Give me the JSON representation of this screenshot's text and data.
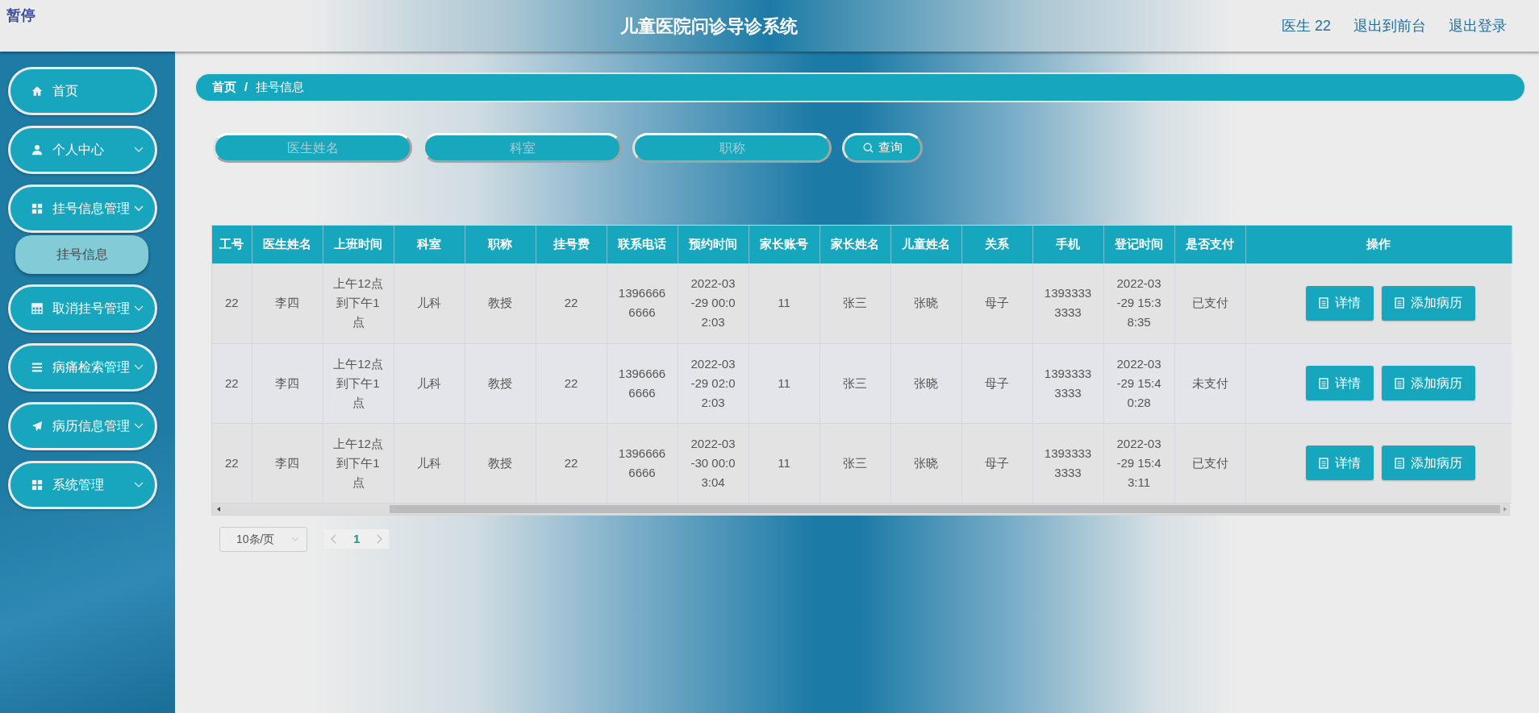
{
  "header": {
    "badge": "暂停",
    "title": "儿童医院问诊导诊系统",
    "links": [
      "医生 22",
      "退出到前台",
      "退出登录"
    ]
  },
  "sidebar": {
    "items": [
      {
        "label": "首页",
        "kind": "home",
        "expandable": false
      },
      {
        "label": "个人中心",
        "kind": "user",
        "expandable": true,
        "expanded": false
      },
      {
        "label": "挂号信息管理",
        "kind": "grid",
        "expandable": true,
        "expanded": true,
        "children": [
          {
            "label": "挂号信息",
            "selected": true
          }
        ]
      },
      {
        "label": "取消挂号管理",
        "kind": "table",
        "expandable": true,
        "expanded": false
      },
      {
        "label": "病痛检索管理",
        "kind": "list",
        "expandable": true,
        "expanded": false
      },
      {
        "label": "病历信息管理",
        "kind": "send",
        "expandable": true,
        "expanded": false
      },
      {
        "label": "系统管理",
        "kind": "grid",
        "expandable": true,
        "expanded": false
      }
    ]
  },
  "breadcrumb": {
    "items": [
      "首页",
      "挂号信息"
    ],
    "separator": "/"
  },
  "search": {
    "fields": [
      {
        "placeholder": "医生姓名"
      },
      {
        "placeholder": "科室"
      },
      {
        "placeholder": "职称"
      }
    ],
    "button": "查询"
  },
  "table": {
    "columns": [
      "工号",
      "医生姓名",
      "上班时间",
      "科室",
      "职称",
      "挂号费",
      "联系电话",
      "预约时间",
      "家长账号",
      "家长姓名",
      "儿童姓名",
      "关系",
      "手机",
      "登记时间",
      "是否支付",
      "操作"
    ],
    "rows": [
      {
        "cells": [
          "22",
          "李四",
          "上午12点到下午1点",
          "儿科",
          "教授",
          "22",
          "13966666666",
          "2022-03-29 00:02:03",
          "11",
          "张三",
          "张晓",
          "母子",
          "13933333333",
          "2022-03-29 15:38:35",
          "已支付"
        ],
        "actions": [
          "详情",
          "添加病历"
        ]
      },
      {
        "cells": [
          "22",
          "李四",
          "上午12点到下午1点",
          "儿科",
          "教授",
          "22",
          "13966666666",
          "2022-03-29 02:02:03",
          "11",
          "张三",
          "张晓",
          "母子",
          "13933333333",
          "2022-03-29 15:40:28",
          "未支付"
        ],
        "actions": [
          "详情",
          "添加病历"
        ]
      },
      {
        "cells": [
          "22",
          "李四",
          "上午12点到下午1点",
          "儿科",
          "教授",
          "22",
          "13966666666",
          "2022-03-30 00:03:04",
          "11",
          "张三",
          "张晓",
          "母子",
          "13933333333",
          "2022-03-29 15:43:11",
          "已支付"
        ],
        "actions": [
          "详情",
          "添加病历"
        ]
      }
    ]
  },
  "pagination": {
    "page_size": "10条/页",
    "pages": [
      {
        "label": "1",
        "selected": true
      }
    ]
  }
}
